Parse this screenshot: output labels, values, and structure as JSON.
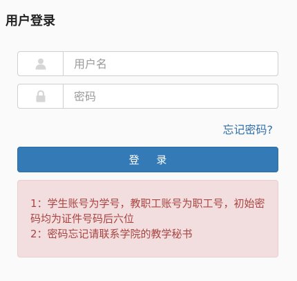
{
  "page": {
    "title": "用户登录"
  },
  "form": {
    "username_placeholder": "用户名",
    "username_value": "",
    "password_placeholder": "密码",
    "password_value": "",
    "username_icon": "user-icon",
    "password_icon": "lock-icon",
    "forgot_link": "忘记密码?",
    "login_button": "登 录"
  },
  "notice": {
    "line1": "1：学生账号为学号，教职工账号为职工号，初始密码均为证件号码后六位",
    "line2": "2：密码忘记请联系学院的教学秘书"
  },
  "colors": {
    "primary": "#337ab7",
    "link": "#2f6fa8",
    "alert_bg": "#f2dede",
    "alert_text": "#a94442"
  }
}
